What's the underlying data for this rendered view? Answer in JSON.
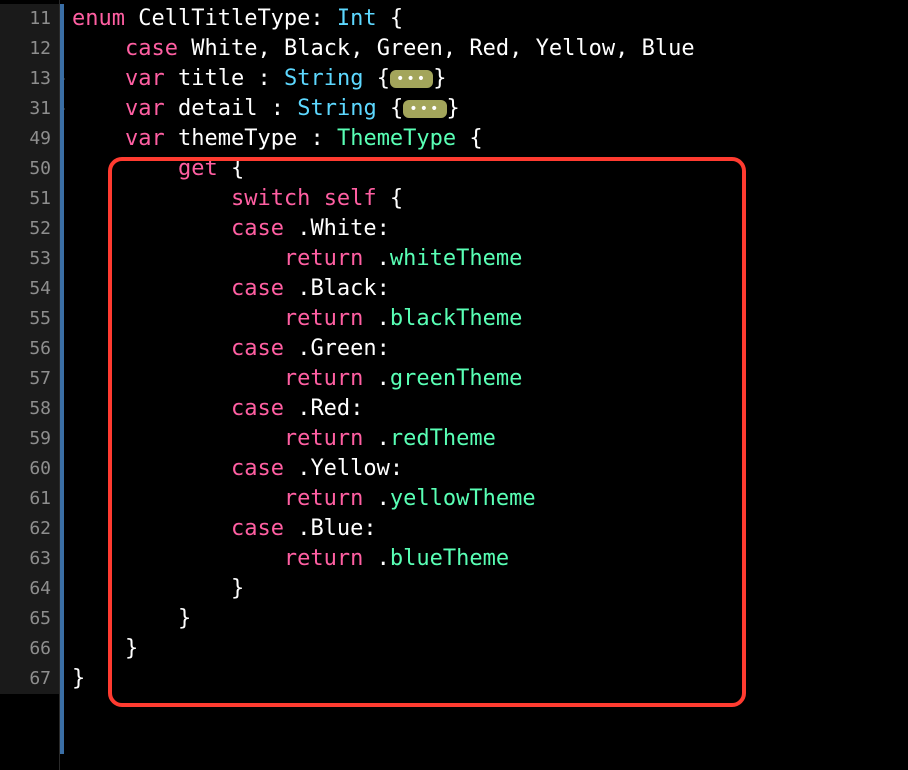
{
  "line_numbers": [
    "11",
    "12",
    "13",
    "31",
    "49",
    "50",
    "51",
    "52",
    "53",
    "54",
    "55",
    "56",
    "57",
    "58",
    "59",
    "60",
    "61",
    "62",
    "63",
    "64",
    "65",
    "66",
    "67"
  ],
  "folded_indices": [
    2,
    3
  ],
  "code": {
    "l0": {
      "kw_enum": "enum",
      "name": "CellTitleType",
      "colon": ":",
      "type": "Int",
      "brace": "{"
    },
    "l1": {
      "kw_case": "case",
      "c0": "White",
      "s0": ", ",
      "c1": "Black",
      "s1": ", ",
      "c2": "Green",
      "s2": ", ",
      "c3": "Red",
      "s3": ", ",
      "c4": "Yellow",
      "s4": ", ",
      "c5": "Blue"
    },
    "l2": {
      "kw_var": "var",
      "name": "title",
      "colon": " : ",
      "type": "String",
      "ob": "{",
      "fold": "•••",
      "cb": "}"
    },
    "l3": {
      "kw_var": "var",
      "name": "detail",
      "colon": " : ",
      "type": "String",
      "ob": "{",
      "fold": "•••",
      "cb": "}"
    },
    "l4": {
      "kw_var": "var",
      "name": "themeType",
      "colon": " : ",
      "type": "ThemeType",
      "ob": "{"
    },
    "l5": {
      "kw_get": "get",
      "ob": "{"
    },
    "l6": {
      "kw_switch": "switch",
      "kw_self": "self",
      "ob": "{"
    },
    "l7": {
      "kw_case": "case",
      "dot": ".",
      "member": "White",
      "colon": ":"
    },
    "l8": {
      "kw_return": "return",
      "dot": ".",
      "member": "whiteTheme"
    },
    "l9": {
      "kw_case": "case",
      "dot": ".",
      "member": "Black",
      "colon": ":"
    },
    "l10": {
      "kw_return": "return",
      "dot": ".",
      "member": "blackTheme"
    },
    "l11": {
      "kw_case": "case",
      "dot": ".",
      "member": "Green",
      "colon": ":"
    },
    "l12": {
      "kw_return": "return",
      "dot": ".",
      "member": "greenTheme"
    },
    "l13": {
      "kw_case": "case",
      "dot": ".",
      "member": "Red",
      "colon": ":"
    },
    "l14": {
      "kw_return": "return",
      "dot": ".",
      "member": "redTheme"
    },
    "l15": {
      "kw_case": "case",
      "dot": ".",
      "member": "Yellow",
      "colon": ":"
    },
    "l16": {
      "kw_return": "return",
      "dot": ".",
      "member": "yellowTheme"
    },
    "l17": {
      "kw_case": "case",
      "dot": ".",
      "member": "Blue",
      "colon": ":"
    },
    "l18": {
      "kw_return": "return",
      "dot": ".",
      "member": "blueTheme"
    },
    "l19": {
      "cb": "}"
    },
    "l20": {
      "cb": "}"
    },
    "l21": {
      "cb": "}"
    },
    "l22": {
      "cb": "}"
    }
  }
}
